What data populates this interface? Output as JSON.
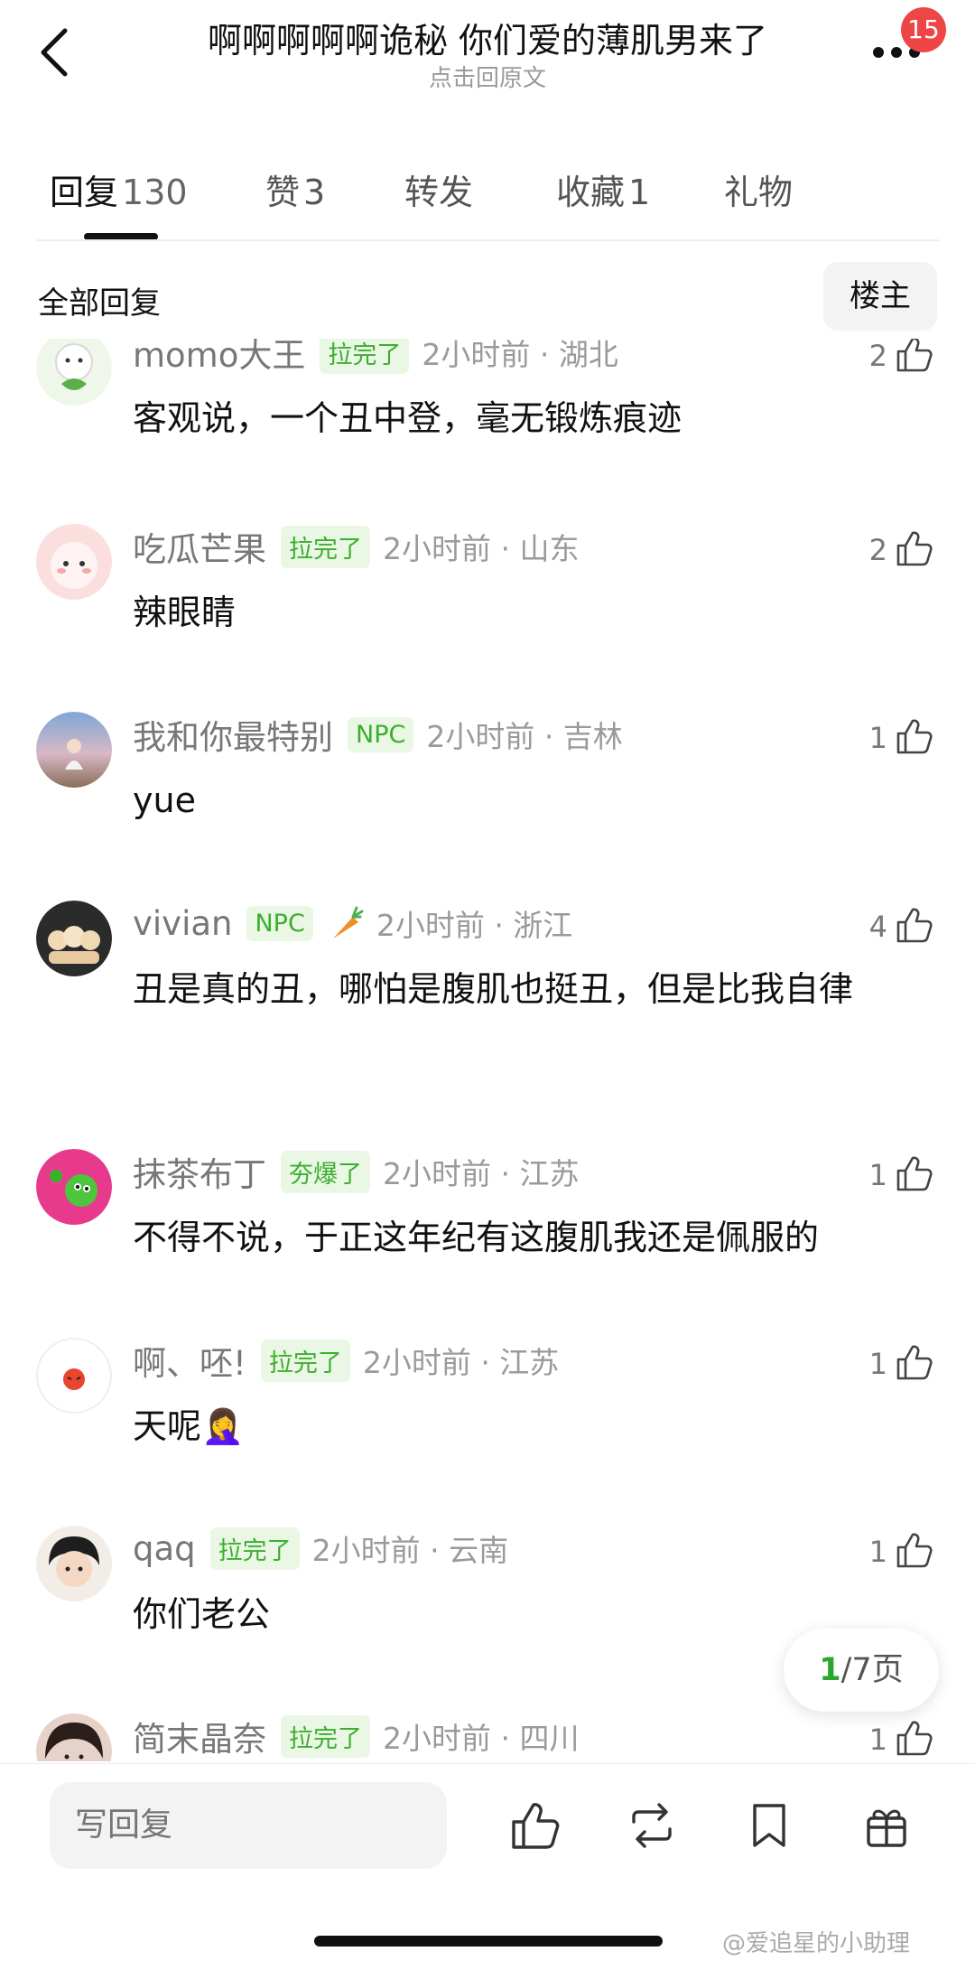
{
  "header": {
    "title": "啊啊啊啊啊诡秘 你们爱的薄肌男来了",
    "subtitle": "点击回原文",
    "badge_count": "15"
  },
  "tabs": [
    {
      "name": "回复",
      "count": "130"
    },
    {
      "name": "赞",
      "count": "3"
    },
    {
      "name": "转发",
      "count": ""
    },
    {
      "name": "收藏",
      "count": "1"
    },
    {
      "name": "礼物",
      "count": ""
    }
  ],
  "filter": {
    "all_label": "全部回复",
    "op_label": "楼主"
  },
  "comments": [
    {
      "nick": "momo大王",
      "tag": "拉完了",
      "time": "2小时前 · 湖北",
      "likes": "2",
      "text": "客观说，一个丑中登，毫无锻炼痕迹"
    },
    {
      "nick": "吃瓜芒果",
      "tag": "拉完了",
      "time": "2小时前 · 山东",
      "likes": "2",
      "text": "辣眼睛"
    },
    {
      "nick": "我和你最特别",
      "tag": "NPC",
      "time": "2小时前 · 吉林",
      "likes": "1",
      "text": "yue"
    },
    {
      "nick": "vivian",
      "tag": "NPC",
      "time": "2小时前 · 浙江",
      "likes": "4",
      "text": "丑是真的丑，哪怕是腹肌也挺丑，但是比我自律"
    },
    {
      "nick": "抹茶布丁",
      "tag": "夯爆了",
      "time": "2小时前 · 江苏",
      "likes": "1",
      "text": "不得不说，于正这年纪有这腹肌我还是佩服的"
    },
    {
      "nick": "啊、呸!",
      "tag": "拉完了",
      "time": "2小时前 · 江苏",
      "likes": "1",
      "text": "天呢🤦‍♀️"
    },
    {
      "nick": "qaq",
      "tag": "拉完了",
      "time": "2小时前 · 云南",
      "likes": "1",
      "text": "你们老公"
    },
    {
      "nick": "简末晶奈",
      "tag": "拉完了",
      "time": "2小时前 · 四川",
      "likes": "1",
      "text": ""
    }
  ],
  "pager": {
    "current": "1",
    "rest": "/7页"
  },
  "bottom": {
    "reply_placeholder": "写回复"
  },
  "watermark": "@爱追星的小助理",
  "colors": {
    "accent_green": "#3cae2f",
    "tag_bg": "#e9f7e4",
    "badge_red": "#ee4545"
  },
  "icons": {
    "back": "chevron-left-icon",
    "more": "more-icon",
    "like": "thumb-up-icon",
    "repost": "repost-icon",
    "bookmark": "bookmark-icon",
    "gift": "gift-icon"
  }
}
